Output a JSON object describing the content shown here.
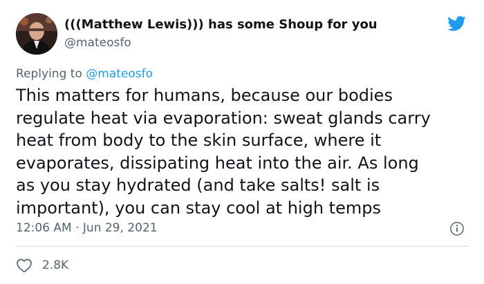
{
  "tweet": {
    "display_name": "(((Matthew Lewis))) has some Shoup for you",
    "handle": "@mateosfo",
    "reply_prefix": "Replying to ",
    "reply_to": "@mateosfo",
    "body_lines": [
      "This matters for humans, because our bodies",
      "regulate heat via evaporation: sweat glands carry",
      "heat from body to the skin surface, where it",
      "evaporates, dissipating heat into the air. As long",
      "as you stay hydrated (and take salts! salt is",
      "important), you can stay cool at high temps"
    ],
    "timestamp": "12:06 AM · Jun 29, 2021",
    "like_count": "2.8K"
  },
  "icons": {
    "logo": "twitter-bird-icon",
    "info": "info-icon",
    "like": "heart-icon"
  },
  "colors": {
    "brand": "#1d9bf0",
    "text_primary": "#0f1419",
    "text_secondary": "#536471",
    "divider": "#cfd9de"
  }
}
